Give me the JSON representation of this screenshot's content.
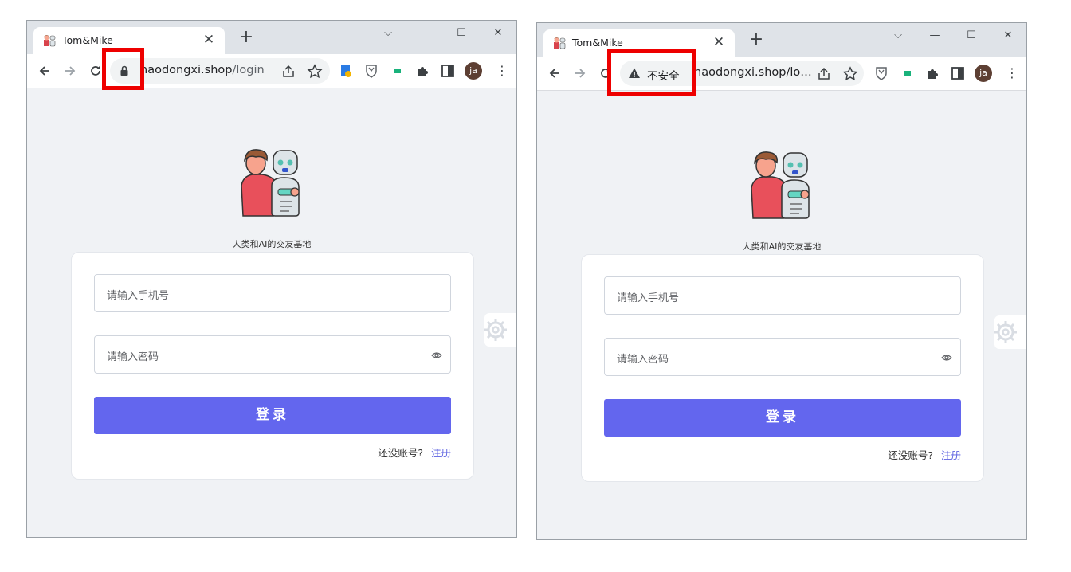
{
  "tab": {
    "title": "Tom&Mike",
    "close": "✕"
  },
  "newtab": "+",
  "window_controls": {
    "dropdown": "⌵",
    "minimize": "—",
    "maximize": "☐",
    "close": "✕"
  },
  "left": {
    "url_host": "haodongxi.shop",
    "url_path": "/login",
    "security_icon": "lock-icon"
  },
  "right": {
    "security_label": "不安全",
    "url_text": "haodongxi.shop/lo…",
    "security_icon": "warning-icon"
  },
  "avatar_text": "ja",
  "page": {
    "tagline": "人类和AI的交友基地",
    "phone_placeholder": "请输入手机号",
    "password_placeholder": "请输入密码",
    "login_button": "登录",
    "no_account": "还没账号?",
    "register_link": "注册"
  },
  "colors": {
    "accent": "#6366ee",
    "highlight": "#ee0000",
    "background": "#f0f2f5"
  }
}
